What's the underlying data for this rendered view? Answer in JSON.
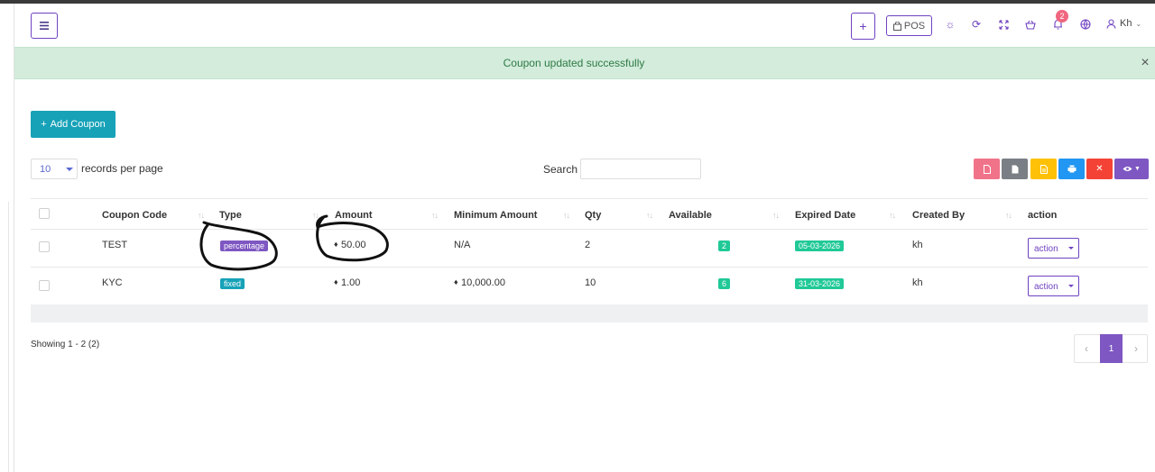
{
  "header": {
    "menu_icon": "hamburger-icon",
    "pos_label": "POS",
    "notification_count": "2",
    "user_name": "Kh"
  },
  "alert": {
    "message": "Coupon updated successfully",
    "close": "×"
  },
  "toolbar": {
    "add_label": "Add Coupon",
    "per_page_value": "10",
    "per_page_label": "records per page",
    "search_label": "Search",
    "export_buttons": [
      {
        "name": "pdf",
        "color": "#f0738a"
      },
      {
        "name": "csv",
        "color": "#7a7f85"
      },
      {
        "name": "excel",
        "color": "#ffc107"
      },
      {
        "name": "print",
        "color": "#2196f3"
      },
      {
        "name": "delete",
        "color": "#f44336"
      },
      {
        "name": "view",
        "color": "#7e57c2"
      }
    ]
  },
  "table": {
    "columns": [
      "Coupon Code",
      "Type",
      "Amount",
      "Minimum Amount",
      "Qty",
      "Available",
      "Expired Date",
      "Created By",
      "action"
    ],
    "rows": [
      {
        "code": "TEST",
        "type": "percentage",
        "type_color": "#7e57c2",
        "amount": "50.00",
        "min_amount": "N/A",
        "qty": "2",
        "available": "2",
        "expired": "05-03-2026",
        "created_by": "kh",
        "action": "action"
      },
      {
        "code": "KYC",
        "type": "fixed",
        "type_color": "#17a2b8",
        "amount": "1.00",
        "min_amount": "10,000.00",
        "qty": "10",
        "available": "6",
        "expired": "31-03-2026",
        "created_by": "kh",
        "action": "action"
      }
    ]
  },
  "footer": {
    "showing": "Showing 1 - 2 (2)",
    "current_page": "1",
    "prev": "‹",
    "next": "›"
  },
  "colors": {
    "accent": "#6f42c1",
    "success_bg": "#d3ecdc",
    "badge_green": "#20c997"
  }
}
